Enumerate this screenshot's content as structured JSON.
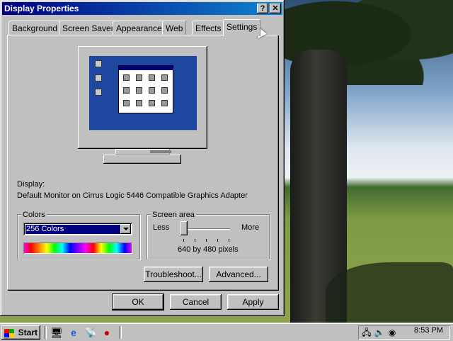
{
  "window": {
    "title": "Display Properties",
    "help_label": "?",
    "close_label": "✕"
  },
  "tabs": [
    {
      "label": "Background"
    },
    {
      "label": "Screen Saver"
    },
    {
      "label": "Appearance"
    },
    {
      "label": "Web"
    },
    {
      "label": "Effects"
    },
    {
      "label": "Settings",
      "active": true
    }
  ],
  "settings": {
    "display_label": "Display:",
    "display_value": "Default Monitor on Cirrus Logic 5446 Compatible Graphics Adapter",
    "colors": {
      "legend": "Colors",
      "selected": "256 Colors"
    },
    "screen_area": {
      "legend": "Screen area",
      "less_label": "Less",
      "more_label": "More",
      "resolution": "640 by 480 pixels",
      "slider_position": 0.0
    },
    "troubleshoot_label": "Troubleshoot...",
    "advanced_label": "Advanced..."
  },
  "footer": {
    "ok_label": "OK",
    "cancel_label": "Cancel",
    "apply_label": "Apply"
  },
  "taskbar": {
    "start_label": "Start",
    "clock": "8:53 PM",
    "quick_launch_icons": [
      "desktop-icon",
      "internet-explorer-icon",
      "channels-icon",
      "outlook-express-icon"
    ],
    "tray_icons": [
      "network-icon",
      "volume-icon",
      "scheduler-icon"
    ]
  }
}
